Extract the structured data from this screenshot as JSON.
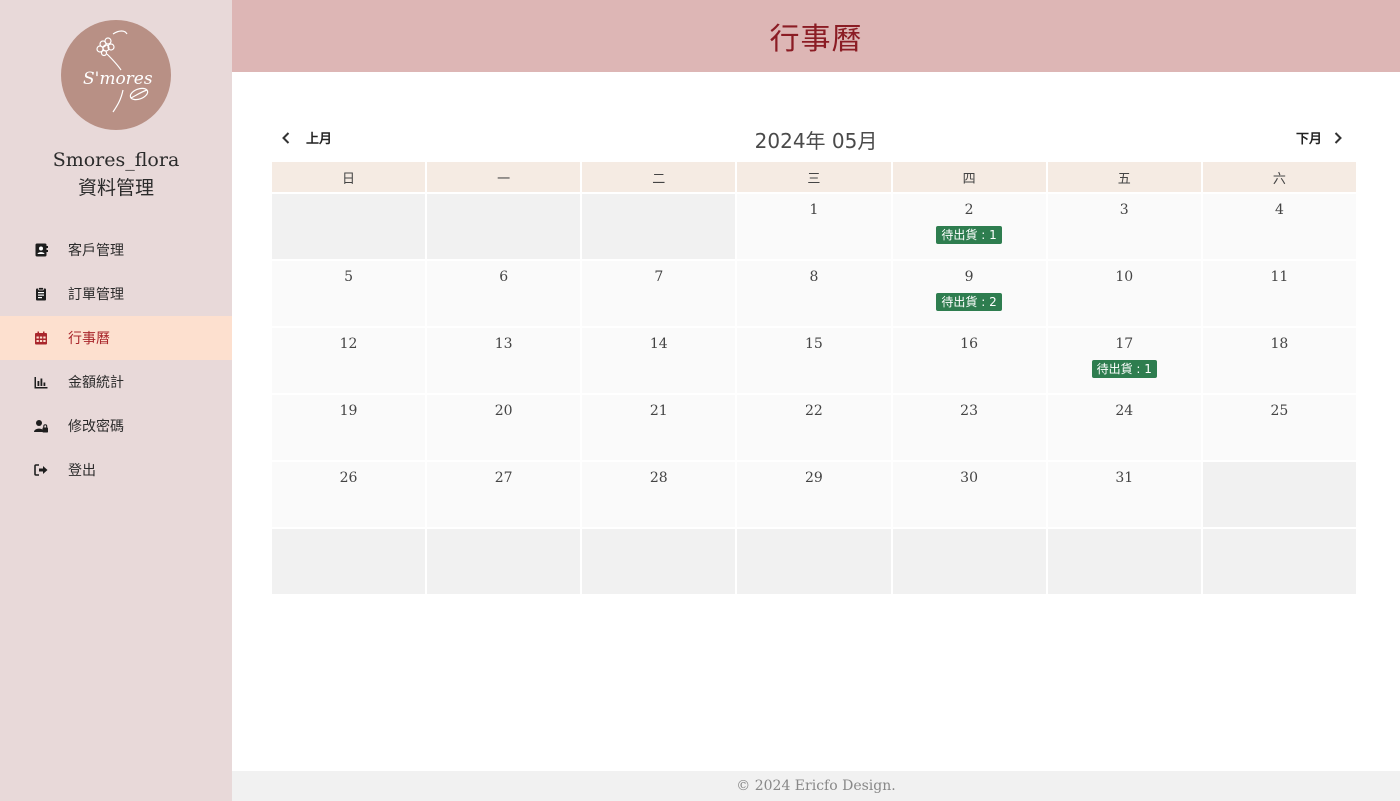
{
  "sidebar": {
    "logo_text": "S'mores",
    "brand_line1": "Smores_flora",
    "brand_line2": "資料管理",
    "items": [
      {
        "label": "客戶管理",
        "icon": "address-book-icon"
      },
      {
        "label": "訂單管理",
        "icon": "clipboard-icon"
      },
      {
        "label": "行事曆",
        "icon": "calendar-icon"
      },
      {
        "label": "金額統計",
        "icon": "bar-chart-icon"
      },
      {
        "label": "修改密碼",
        "icon": "user-lock-icon"
      },
      {
        "label": "登出",
        "icon": "sign-out-icon"
      }
    ],
    "active_index": 2
  },
  "header": {
    "title": "行事曆"
  },
  "calendar": {
    "prev_label": "上月",
    "next_label": "下月",
    "month_title": "2024年 05月",
    "weekdays": [
      "日",
      "一",
      "二",
      "三",
      "四",
      "五",
      "六"
    ],
    "weeks": [
      [
        {
          "day": ""
        },
        {
          "day": ""
        },
        {
          "day": ""
        },
        {
          "day": "1"
        },
        {
          "day": "2",
          "badge": "待出貨 : 1"
        },
        {
          "day": "3"
        },
        {
          "day": "4"
        }
      ],
      [
        {
          "day": "5"
        },
        {
          "day": "6"
        },
        {
          "day": "7"
        },
        {
          "day": "8"
        },
        {
          "day": "9",
          "badge": "待出貨 : 2"
        },
        {
          "day": "10"
        },
        {
          "day": "11"
        }
      ],
      [
        {
          "day": "12"
        },
        {
          "day": "13"
        },
        {
          "day": "14"
        },
        {
          "day": "15"
        },
        {
          "day": "16"
        },
        {
          "day": "17",
          "badge": "待出貨 : 1"
        },
        {
          "day": "18"
        }
      ],
      [
        {
          "day": "19"
        },
        {
          "day": "20"
        },
        {
          "day": "21"
        },
        {
          "day": "22"
        },
        {
          "day": "23"
        },
        {
          "day": "24"
        },
        {
          "day": "25"
        }
      ],
      [
        {
          "day": "26"
        },
        {
          "day": "27"
        },
        {
          "day": "28"
        },
        {
          "day": "29"
        },
        {
          "day": "30"
        },
        {
          "day": "31"
        },
        {
          "day": ""
        }
      ],
      [
        {
          "day": ""
        },
        {
          "day": ""
        },
        {
          "day": ""
        },
        {
          "day": ""
        },
        {
          "day": ""
        },
        {
          "day": ""
        },
        {
          "day": ""
        }
      ]
    ],
    "badge_color": "#2e7d4f"
  },
  "footer": {
    "text": "© 2024 Ericfo Design."
  },
  "colors": {
    "sidebar_bg": "#e8d9d9",
    "header_bg": "#ddb6b5",
    "accent": "#a9262b",
    "active_bg": "#fde0cf"
  }
}
